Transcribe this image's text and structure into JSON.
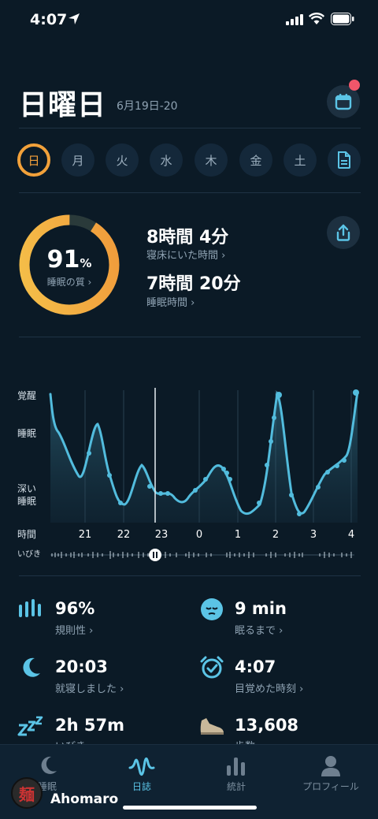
{
  "status": {
    "time": "4:07"
  },
  "header": {
    "title": "日曜日",
    "date_range": "6月19日-20"
  },
  "days": [
    {
      "label": "日",
      "active": true
    },
    {
      "label": "月"
    },
    {
      "label": "火"
    },
    {
      "label": "水"
    },
    {
      "label": "木"
    },
    {
      "label": "金"
    },
    {
      "label": "土"
    }
  ],
  "summary": {
    "quality_value": "91",
    "quality_unit": "%",
    "quality_fraction": 0.91,
    "quality_label": "睡眠の質 ›",
    "in_bed_value": "8時間 4分",
    "in_bed_label": "寝床にいた時間 ›",
    "sleep_value": "7時間 20分",
    "sleep_label": "睡眠時間 ›"
  },
  "chart_data": {
    "type": "area",
    "y_categories": [
      "覚醒",
      "睡眠",
      "深い睡眠"
    ],
    "x_axis_title": "時間",
    "x_ticks": [
      "21",
      "22",
      "23",
      "0",
      "1",
      "2",
      "3",
      "4"
    ],
    "snore_label": "いびき",
    "current_marker": "23"
  },
  "metrics": [
    {
      "value": "96%",
      "label": "規則性 ›",
      "icon": "regularity-icon"
    },
    {
      "value": "9 min",
      "label": "眠るまで ›",
      "icon": "sleepy-face-icon"
    },
    {
      "value": "20:03",
      "label": "就寝しました ›",
      "icon": "moon-icon"
    },
    {
      "value": "4:07",
      "label": "目覚めた時刻 ›",
      "icon": "alarm-clock-icon"
    },
    {
      "value": "2h 57m",
      "label": "いびき ›",
      "icon": "snore-zzz-icon"
    },
    {
      "value": "13,608",
      "label": "歩数 ›",
      "icon": "shoe-icon"
    }
  ],
  "tabs": [
    {
      "label": "睡眠",
      "icon": "moon-icon"
    },
    {
      "label": "日誌",
      "icon": "wave-icon",
      "active": true
    },
    {
      "label": "統計",
      "icon": "bar-chart-icon"
    },
    {
      "label": "プロフィール",
      "icon": "person-icon"
    }
  ],
  "watermark": {
    "logo_text": "麺",
    "name": "Ahomaro"
  },
  "colors": {
    "accent": "#5bc4e6",
    "ring": "#f2a13a",
    "bg": "#0b1a26"
  }
}
